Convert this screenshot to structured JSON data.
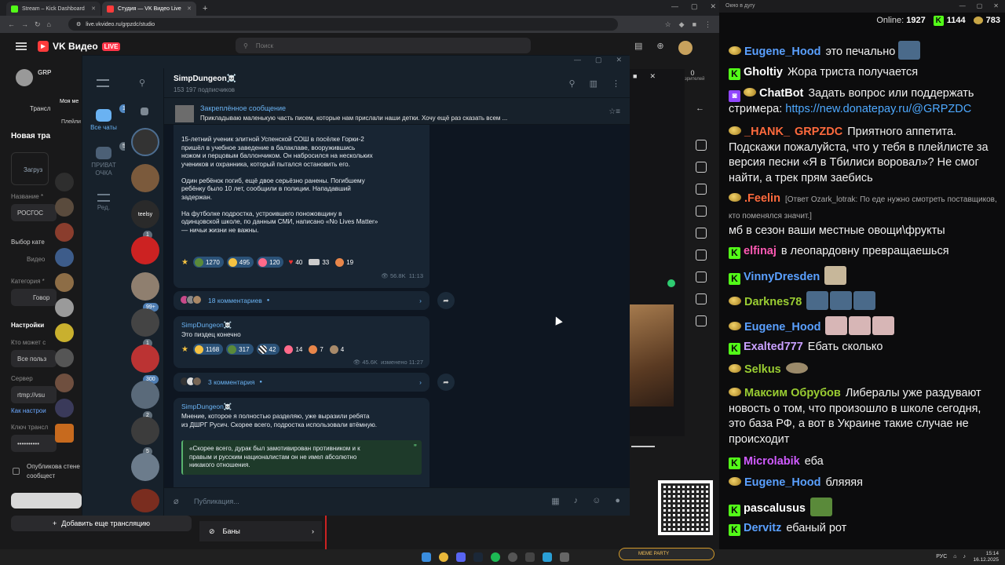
{
  "browser": {
    "tabs": [
      {
        "label": "Stream – Kick Dashboard",
        "color": "#53fc18"
      },
      {
        "label": "Студия — VK Видео Live",
        "color": "#ff3b3b"
      }
    ],
    "url": "live.vkvideo.ru/grpzdc/studio"
  },
  "vk": {
    "logo": "VK Видео",
    "live": "LIVE",
    "search_placeholder": "Поиск",
    "left": {
      "title": "Новая тра",
      "upload": "Загруз",
      "name_label": "Название *",
      "name_value": "РОСГОС",
      "category_choice": "Выбор кате",
      "video": "Видео",
      "category_label": "Категория *",
      "category_value": "Говор",
      "settings": "Настройки",
      "who_can": "Кто может с",
      "all_users": "Все польз",
      "server_label": "Сервер",
      "server_value": "rtmp://vsu",
      "how_setup": "Как настрои",
      "key_label": "Ключ трансл",
      "key_value": "••••••••••",
      "publish": "Опубликова стене сообщест",
      "add_stream": "Добавить еще трансляцию",
      "bans": "Баны",
      "my_me": "Моя ме",
      "playlists": "Плейли",
      "grp": "GRP",
      "tab_trans": "Трансл"
    },
    "preview_counter": "0",
    "preview_counter_label": "зрителей"
  },
  "telegram": {
    "nav": [
      {
        "label": "Все чаты",
        "badge": "18"
      },
      {
        "label": "ПРИВАТ ОЧКА",
        "badge": "5"
      },
      {
        "label": "Ред.",
        "badge": ""
      }
    ],
    "chat_badges": [
      "1",
      "99+",
      "1",
      "300",
      "2",
      "5"
    ],
    "chat_avatar_text": "teelsy",
    "channel": {
      "name": "SimpDungeon☠️",
      "subscribers": "153 197 подписчиков"
    },
    "pinned": {
      "title": "Закреплённое сообщение",
      "text": "Прикладываю маленькую часть писем, которые нам прислали наши детки.   Хочу ещё раз сказать всем ..."
    },
    "posts": [
      {
        "text": "15-летний ученик элитной Успенской СОШ в посёлке Горки-2\nпришёл в учебное заведение в балаклаве, вооружившись\nножом и перцовым баллончиком. Он набросился на нескольких\nучеников и охранника, который пытался остановить его.\n\nОдин ребёнок погиб, ещё двое серьёзно ранены. Погибшему\nребёнку было 10 лет, сообщили в полиции. Нападавший\nзадержан.\n\nНа футболке подростка, устроившего поножовщину в\nодинцовской школе, по данным СМИ, написано «No Lives Matter»\n— ничьи жизни не важны.",
        "reactions": [
          "1270",
          "495",
          "120",
          "40",
          "33",
          "19"
        ],
        "views": "56.8K",
        "time": "11:13",
        "comments": "18 комментариев"
      },
      {
        "author": "SimpDungeon☠️",
        "text": "Это пиздец конечно",
        "reactions": [
          "1168",
          "317",
          "42",
          "14",
          "7",
          "4"
        ],
        "views": "45.6K",
        "time": "изменено 11:27",
        "comments": "3 комментария"
      },
      {
        "author": "SimpDungeon☠️",
        "text": "Мнение, которое я полностью разделяю, уже выразили ребята\nиз ДШРГ Русич. Скорее всего, подростка использовали втёмную.",
        "quote": "«Скорее всего, дурак был замотивирован противником и к\nправым и русским националистам он не имел абсолютно\nникакого отношения."
      }
    ],
    "composer_placeholder": "Публикация..."
  },
  "chat": {
    "window_title": "Окно в дугу",
    "online_label": "Online:",
    "online": "1927",
    "kick_count": "1144",
    "coin_count": "783",
    "messages": [
      {
        "user": "Eugene_Hood",
        "color": "#5aa0ff",
        "badge": "coin",
        "text": "это печально"
      },
      {
        "user": "Gholtiy",
        "color": "#ffffff",
        "badge": "k",
        "text": "Жора триста получается"
      },
      {
        "user": "ChatBot",
        "color": "#ffffff",
        "badge": "twitch",
        "text": "Задать вопрос или поддержать стримера:",
        "link": "https://new.donatepay.ru/@GRPZDC"
      },
      {
        "user": "_HANK_",
        "color": "#ff6a3d",
        "badge": "coin",
        "prefix": "GRPZDC",
        "text": "Приятного аппетита. Подскажи пожалуйста, что у тебя в плейлисте за версия песни «Я в Тбилиси воровал»? Не смог найти, а трек прям заебись"
      },
      {
        "user": ".Feelin",
        "color": "#ff6a3d",
        "badge": "coin",
        "reply": "[Ответ Ozark_lotrak: По еде нужно смотреть поставщиков, кто поменялся значит.]",
        "text": "мб в сезон ваши местные овощи\\фрукты"
      },
      {
        "user": "elfinaj",
        "color": "#ff5ab4",
        "badge": "k",
        "text": "в леопардовну превращаешься"
      },
      {
        "user": "VinnyDresden",
        "color": "#5aa0ff",
        "badge": "k",
        "text": ""
      },
      {
        "user": "Darknes78",
        "color": "#9acd32",
        "badge": "coin",
        "text": ""
      },
      {
        "user": "Eugene_Hood",
        "color": "#5aa0ff",
        "badge": "coin",
        "text": ""
      },
      {
        "user": "Exalted777",
        "color": "#c9a0ff",
        "badge": "k",
        "text": "Ебать сколько"
      },
      {
        "user": "Selkus",
        "color": "#9acd32",
        "badge": "coin",
        "text": ""
      },
      {
        "user": "Максим Обрубов",
        "color": "#9acd32",
        "badge": "coin",
        "text": "Либералы уже раздувают новость о том, что произошло в школе сегодня, это база РФ, а вот в Украине такие случае не происходит"
      },
      {
        "user": "Microlabik",
        "color": "#d05bff",
        "badge": "k",
        "text": "еба"
      },
      {
        "user": "Eugene_Hood",
        "color": "#5aa0ff",
        "badge": "coin",
        "text": "бляяяя"
      },
      {
        "user": "pascalusus",
        "color": "#ffffff",
        "badge": "k",
        "text": ""
      },
      {
        "user": "Dervitz",
        "color": "#5aa0ff",
        "badge": "k",
        "text": "ебаный рот"
      }
    ]
  },
  "taskbar": {
    "lang": "РУС",
    "time": "15:14",
    "date": "16.12.2025",
    "meme": "MEME PARTY"
  }
}
